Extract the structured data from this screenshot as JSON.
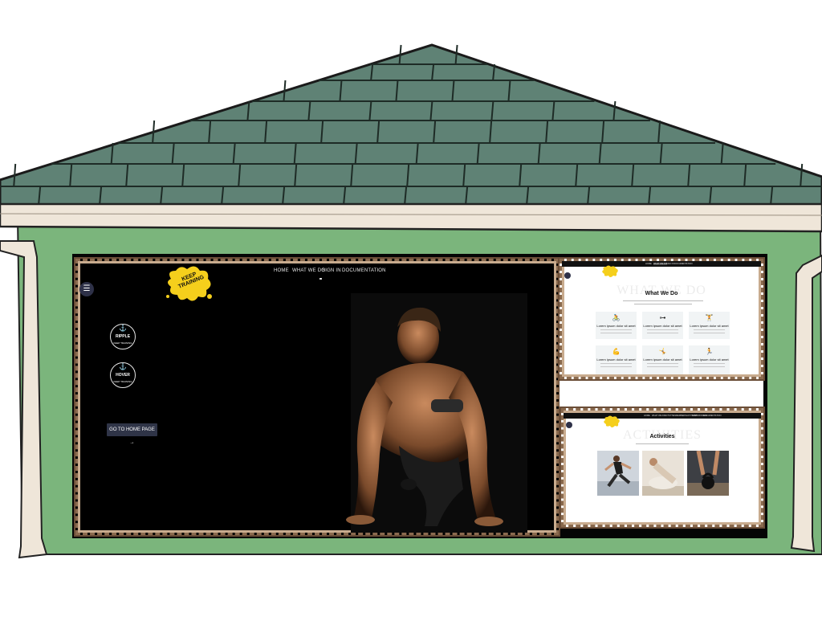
{
  "main_site": {
    "logo_text": "KEEP TRAINING",
    "nav": [
      "HOME",
      "WHAT WE DO",
      "SIGN IN",
      "DOCUMENTATION"
    ],
    "menu_icon": "hamburger-icon",
    "badges": [
      {
        "title": "RIPPLE",
        "sub": "KEEP TRAINING"
      },
      {
        "title": "HOVER",
        "sub": "KEEP TRAINING"
      }
    ],
    "home_button": "GO TO HOME PAGE →"
  },
  "what_we_do": {
    "bg_title": "WHAT WE DO",
    "title": "What We Do",
    "nav": [
      "HOME",
      "WHAT WE DO",
      "SIGN IN",
      "DOCUMENTATION"
    ],
    "cards": [
      {
        "icon": "cycling-icon",
        "title": "Lorem ipsum dolor sit amet"
      },
      {
        "icon": "dumbbell-icon",
        "title": "Lorem ipsum dolor sit amet"
      },
      {
        "icon": "weightlifting-icon",
        "title": "Lorem ipsum dolor sit amet"
      },
      {
        "icon": "muscle-arm-icon",
        "title": "Lorem ipsum dolor sit amet"
      },
      {
        "icon": "gymnast-icon",
        "title": "Lorem ipsum dolor sit amet"
      },
      {
        "icon": "running-icon",
        "title": "Lorem ipsum dolor sit amet"
      }
    ]
  },
  "activities": {
    "bg_title": "ACTIVITIES",
    "title": "Activities",
    "nav": [
      "HOME",
      "WHAT WE DO",
      "ACTIVITIES",
      "MEMBERSHIP PLANS",
      "TESTIMONIALS",
      "DOCUMENTATION"
    ]
  },
  "colors": {
    "roof": "#5f8275",
    "wall": "#7bb57c",
    "trim": "#efe6d9",
    "frame": "#8a6a4e",
    "accent_yellow": "#f5cf1c",
    "button": "#2f3447"
  }
}
